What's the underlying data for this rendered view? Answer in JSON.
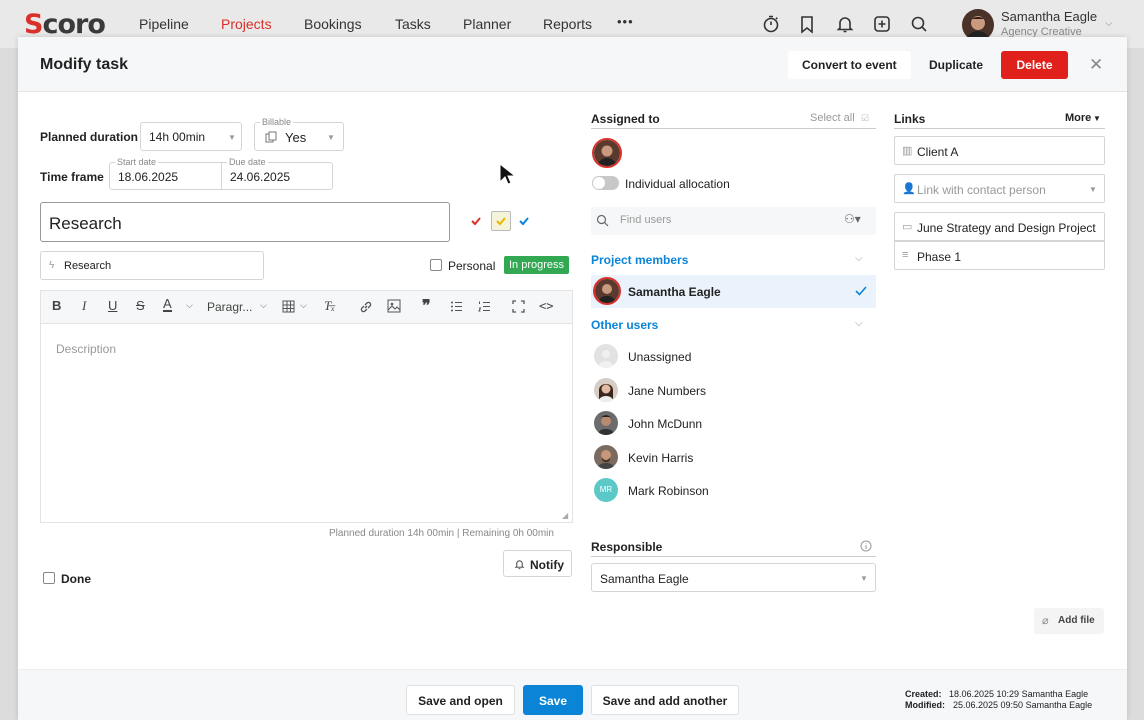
{
  "topbar": {
    "logo": "Scoro",
    "nav": [
      "Pipeline",
      "Projects",
      "Bookings",
      "Tasks",
      "Planner",
      "Reports"
    ],
    "active_nav": "Projects",
    "more": "•••",
    "user_name": "Samantha Eagle",
    "user_role": "Agency Creative"
  },
  "modal": {
    "title": "Modify task",
    "convert_label": "Convert to event",
    "duplicate_label": "Duplicate",
    "delete_label": "Delete",
    "close": "✕"
  },
  "form": {
    "planned_duration_label": "Planned duration",
    "planned_duration_value": "14h 00min",
    "billable_label": "Billable",
    "billable_value": "Yes",
    "time_frame_label": "Time frame",
    "start_date_label": "Start date",
    "start_date": "18.06.2025",
    "due_date_label": "Due date",
    "due_date": "24.06.2025",
    "task_name": "Research",
    "activity": "Research",
    "personal_label": "Personal",
    "status": "In progress",
    "paragraph_label": "Paragr...",
    "description_placeholder": "Description",
    "duration_summary": "Planned duration 14h 00min | Remaining 0h 00min",
    "notify_label": "Notify",
    "done_label": "Done"
  },
  "assigned": {
    "title": "Assigned to",
    "select_all": "Select all",
    "individual_allocation": "Individual allocation",
    "find_users_placeholder": "Find users",
    "project_members_label": "Project members",
    "project_members": [
      {
        "name": "Samantha Eagle",
        "selected": true
      }
    ],
    "other_users_label": "Other users",
    "other_users": [
      {
        "name": "Unassigned",
        "initials": ""
      },
      {
        "name": "Jane Numbers",
        "initials": ""
      },
      {
        "name": "John McDunn",
        "initials": ""
      },
      {
        "name": "Kevin Harris",
        "initials": ""
      },
      {
        "name": "Mark Robinson",
        "initials": "MR"
      }
    ],
    "responsible_label": "Responsible",
    "responsible_value": "Samantha Eagle"
  },
  "links": {
    "title": "Links",
    "more": "More",
    "client": "Client A",
    "contact_placeholder": "Link with contact person",
    "project": "June Strategy and Design Project",
    "phase": "Phase 1",
    "add_file": "Add file"
  },
  "footer": {
    "save_open": "Save and open",
    "save": "Save",
    "save_add": "Save and add another",
    "created_label": "Created:",
    "created_value": "18.06.2025 10:29 Samantha Eagle",
    "modified_label": "Modified:",
    "modified_value": "25.06.2025 09:50 Samantha Eagle"
  },
  "colors": {
    "accent": "#0a84d6",
    "danger": "#e0201b",
    "brand_red": "#d9302a",
    "status_green": "#33a853"
  }
}
